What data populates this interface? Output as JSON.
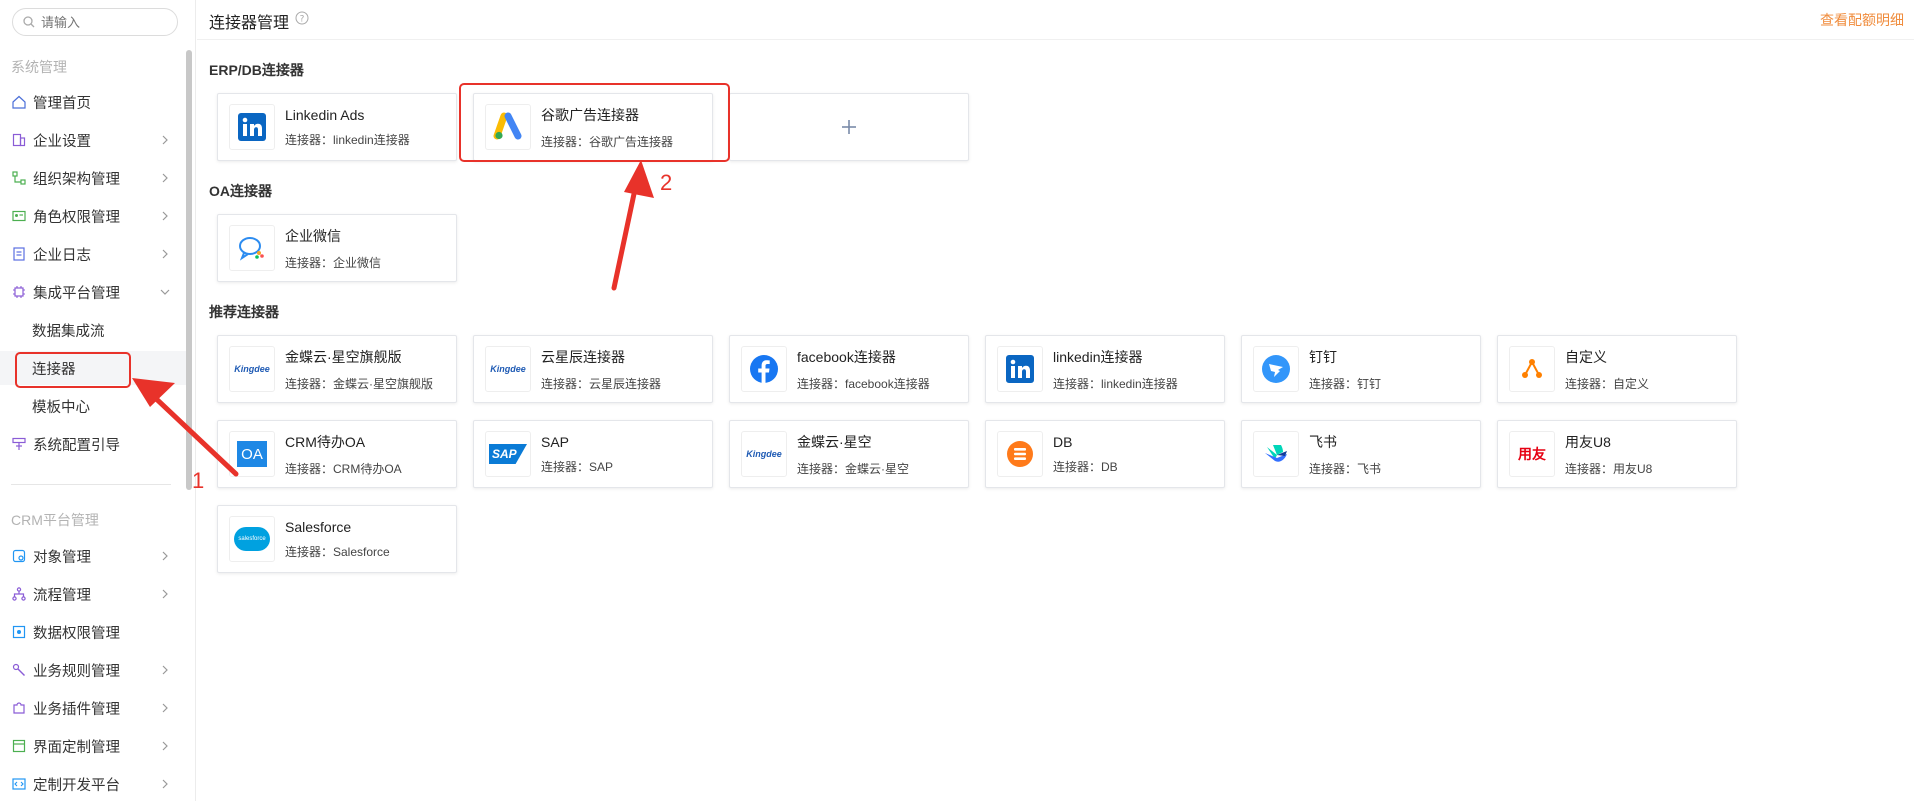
{
  "search": {
    "placeholder": "请输入"
  },
  "sidebar": {
    "group1": "系统管理",
    "items1": [
      {
        "label": "管理首页",
        "icon": "home-icon",
        "chevron": false
      },
      {
        "label": "企业设置",
        "icon": "building-icon",
        "chevron": true
      },
      {
        "label": "组织架构管理",
        "icon": "org-icon",
        "chevron": true
      },
      {
        "label": "角色权限管理",
        "icon": "id-card-icon",
        "chevron": true
      },
      {
        "label": "企业日志",
        "icon": "log-icon",
        "chevron": true
      },
      {
        "label": "集成平台管理",
        "icon": "chip-icon",
        "chevron": "down"
      }
    ],
    "subitems": [
      "数据集成流",
      "连接器",
      "模板中心"
    ],
    "after_sub": {
      "label": "系统配置引导",
      "icon": "guide-icon"
    },
    "group2": "CRM平台管理",
    "items2": [
      {
        "label": "对象管理",
        "icon": "object-icon",
        "chevron": true
      },
      {
        "label": "流程管理",
        "icon": "flow-icon",
        "chevron": true
      },
      {
        "label": "数据权限管理",
        "icon": "data-perm-icon",
        "chevron": false
      },
      {
        "label": "业务规则管理",
        "icon": "rule-icon",
        "chevron": true
      },
      {
        "label": "业务插件管理",
        "icon": "plugin-icon",
        "chevron": true
      },
      {
        "label": "界面定制管理",
        "icon": "layout-icon",
        "chevron": true
      },
      {
        "label": "定制开发平台",
        "icon": "code-icon",
        "chevron": true
      }
    ]
  },
  "header": {
    "title": "连接器管理",
    "quota_link": "查看配额明细"
  },
  "sections": {
    "erp": {
      "title": "ERP/DB连接器",
      "cards": [
        {
          "name": "Linkedin Ads",
          "sub": "连接器：linkedin连接器",
          "logo": "linkedin"
        },
        {
          "name": "谷歌广告连接器",
          "sub": "连接器：谷歌广告连接器",
          "logo": "google-ads"
        }
      ]
    },
    "oa": {
      "title": "OA连接器",
      "cards": [
        {
          "name": "企业微信",
          "sub": "连接器：企业微信",
          "logo": "wecom"
        }
      ]
    },
    "rec": {
      "title": "推荐连接器",
      "cards": [
        {
          "name": "金蝶云·星空旗舰版",
          "sub": "连接器：金蝶云·星空旗舰版",
          "logo": "kingdee"
        },
        {
          "name": "云星辰连接器",
          "sub": "连接器：云星辰连接器",
          "logo": "kingdee"
        },
        {
          "name": "facebook连接器",
          "sub": "连接器：facebook连接器",
          "logo": "facebook"
        },
        {
          "name": "linkedin连接器",
          "sub": "连接器：linkedin连接器",
          "logo": "linkedin"
        },
        {
          "name": "钉钉",
          "sub": "连接器：钉钉",
          "logo": "dingtalk"
        },
        {
          "name": "自定义",
          "sub": "连接器：自定义",
          "logo": "custom"
        },
        {
          "name": "CRM待办OA",
          "sub": "连接器：CRM待办OA",
          "logo": "oa"
        },
        {
          "name": "SAP",
          "sub": "连接器：SAP",
          "logo": "sap"
        },
        {
          "name": "金蝶云·星空",
          "sub": "连接器：金蝶云·星空",
          "logo": "kingdee"
        },
        {
          "name": "DB",
          "sub": "连接器：DB",
          "logo": "db"
        },
        {
          "name": "飞书",
          "sub": "连接器：飞书",
          "logo": "feishu"
        },
        {
          "name": "用友U8",
          "sub": "连接器：用友U8",
          "logo": "yonyou"
        },
        {
          "name": "Salesforce",
          "sub": "连接器：Salesforce",
          "logo": "salesforce"
        }
      ]
    }
  },
  "logo_text": {
    "kingdee": "Kingdee",
    "oa": "OA",
    "sap": "SAP",
    "yonyou": "用友",
    "salesforce": "salesforce"
  },
  "annotations": [
    "1",
    "2"
  ],
  "colors": {
    "accent": "#f08c3c",
    "annotation": "#e8322a",
    "linkedin": "#0a66c2",
    "facebook": "#1877f2"
  }
}
